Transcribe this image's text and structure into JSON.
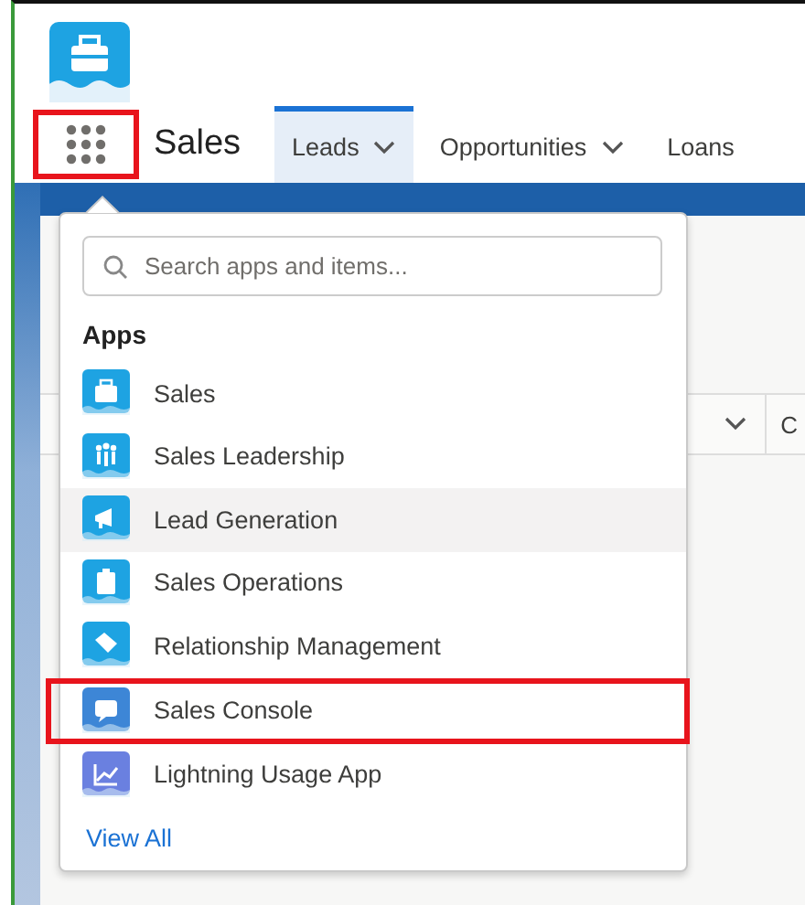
{
  "header": {
    "app_name": "Sales"
  },
  "nav_tabs": [
    {
      "label": "Leads",
      "selected": true,
      "has_menu": true
    },
    {
      "label": "Opportunities",
      "selected": false,
      "has_menu": true
    },
    {
      "label": "Loans",
      "selected": false,
      "has_menu": false
    }
  ],
  "app_launcher": {
    "highlighted": true
  },
  "list_header": {
    "column_2": "C"
  },
  "launcher_menu": {
    "search": {
      "placeholder": "Search apps and items..."
    },
    "section_title": "Apps",
    "apps": [
      {
        "label": "Sales",
        "color": "#1ea3e2",
        "hovered": false,
        "highlighted": false
      },
      {
        "label": "Sales Leadership",
        "color": "#1ea3e2",
        "hovered": false,
        "highlighted": false
      },
      {
        "label": "Lead Generation",
        "color": "#1ea3e2",
        "hovered": true,
        "highlighted": false
      },
      {
        "label": "Sales Operations",
        "color": "#1ea3e2",
        "hovered": false,
        "highlighted": false
      },
      {
        "label": "Relationship Management",
        "color": "#1ea3e2",
        "hovered": false,
        "highlighted": false
      },
      {
        "label": "Sales Console",
        "color": "#3d86d6",
        "hovered": false,
        "highlighted": true
      },
      {
        "label": "Lightning Usage App",
        "color": "#6a80e0",
        "hovered": false,
        "highlighted": false
      }
    ],
    "view_all": "View All"
  }
}
